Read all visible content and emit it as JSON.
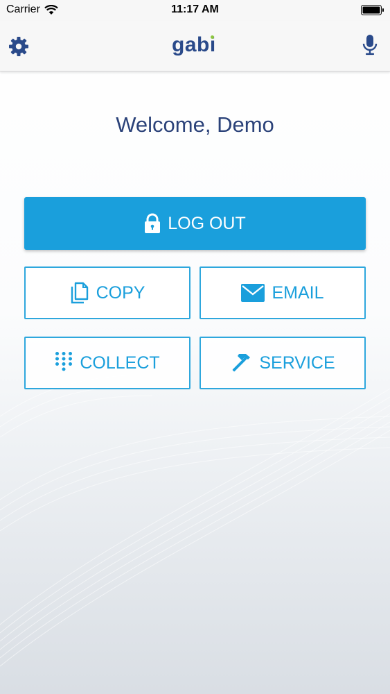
{
  "status_bar": {
    "carrier": "Carrier",
    "time": "11:17 AM"
  },
  "nav": {
    "logo": "gabi",
    "left_icon": "gear-icon",
    "right_icon": "microphone-icon"
  },
  "welcome": {
    "text": "Welcome, Demo"
  },
  "buttons": {
    "logout": {
      "label": "LOG OUT",
      "icon": "lock-icon"
    },
    "copy": {
      "label": "COPY",
      "icon": "documents-icon"
    },
    "email": {
      "label": "EMAIL",
      "icon": "envelope-icon"
    },
    "collect": {
      "label": "COLLECT",
      "icon": "keypad-icon"
    },
    "service": {
      "label": "SERVICE",
      "icon": "hammer-icon"
    }
  },
  "colors": {
    "primary": "#1a9fdc",
    "text_dark": "#2b4279",
    "logo": "#2a4a8a",
    "logo_accent": "#8dc63f",
    "nav_background": "#f7f7f7"
  }
}
